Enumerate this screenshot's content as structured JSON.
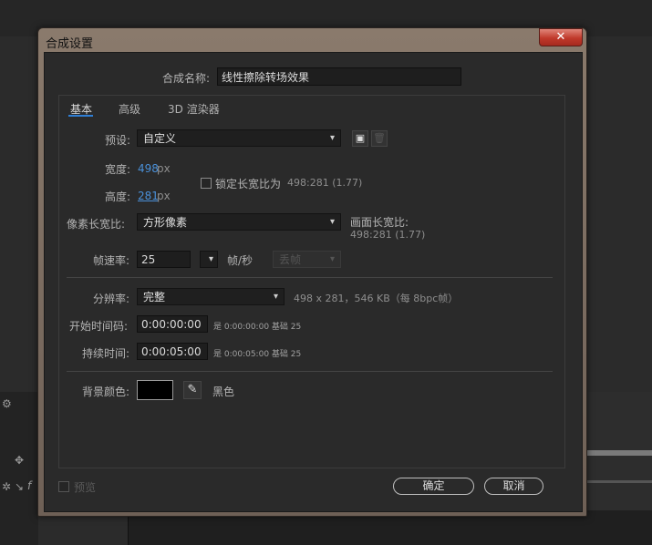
{
  "dialog": {
    "title": "合成设置",
    "close": "✕",
    "comp_name_label": "合成名称:",
    "comp_name_value": "线性擦除转场效果"
  },
  "tabs": [
    "基本",
    "高级",
    "3D 渲染器"
  ],
  "preset": {
    "label": "预设:",
    "value": "自定义"
  },
  "width": {
    "label": "宽度:",
    "value": "498",
    "unit": "px"
  },
  "height": {
    "label": "高度:",
    "value": "281",
    "unit": "px"
  },
  "lock_aspect": {
    "label": "锁定长宽比为",
    "ratio": "498:281 (1.77)"
  },
  "pixel_aspect": {
    "label": "像素长宽比:",
    "value": "方形像素"
  },
  "frame_aspect": {
    "label": "画面长宽比:",
    "value": "498:281 (1.77)"
  },
  "frame_rate": {
    "label": "帧速率:",
    "value": "25",
    "unit": "帧/秒",
    "drop_frame": "丢帧"
  },
  "resolution": {
    "label": "分辨率:",
    "value": "完整",
    "info": "498 x 281，546 KB（每 8bpc帧）"
  },
  "start_timecode": {
    "label": "开始时间码:",
    "value": "0:00:00:00",
    "note": "是 0:00:00:00  基础 25"
  },
  "duration": {
    "label": "持续时间:",
    "value": "0:00:05:00",
    "note": "是 0:00:05:00  基础 25"
  },
  "background": {
    "label": "背景颜色:",
    "color": "#000000",
    "name": "黑色"
  },
  "footer": {
    "preview": "预览",
    "ok": "确定",
    "cancel": "取消"
  }
}
